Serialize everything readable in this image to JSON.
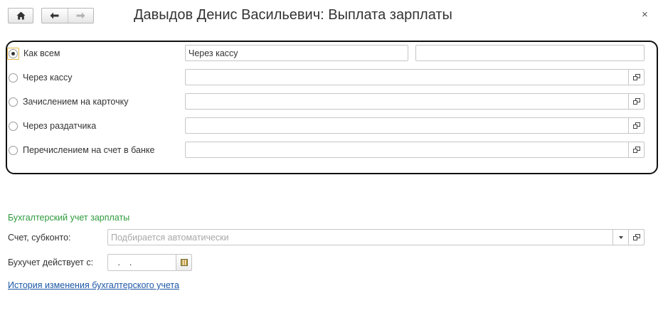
{
  "window": {
    "title": "Давыдов Денис Васильевич: Выплата зарплаты",
    "close_glyph": "×"
  },
  "toolbar": {
    "home_icon": "home-icon",
    "back_icon": "arrow-left-icon",
    "forward_icon": "arrow-right-icon"
  },
  "payment": {
    "options": [
      {
        "label": "Как всем",
        "checked": true
      },
      {
        "label": "Через кассу",
        "checked": false
      },
      {
        "label": "Зачислением на карточку",
        "checked": false
      },
      {
        "label": "Через раздатчика",
        "checked": false
      },
      {
        "label": "Перечислением на счет в банке",
        "checked": false
      }
    ],
    "default_value": "Через кассу",
    "default_extra": ""
  },
  "accounting": {
    "section_title": "Бухгалтерский учет зарплаты",
    "account_label": "Счет, субконто:",
    "account_placeholder": "Подбирается автоматически",
    "effective_label": "Бухучет действует с:",
    "effective_value": " .  . ",
    "history_link": "История изменения бухгалтерского учета"
  },
  "colors": {
    "section_title": "#2e9a3d",
    "link": "#1c57a5",
    "focus": "#e2b645"
  }
}
